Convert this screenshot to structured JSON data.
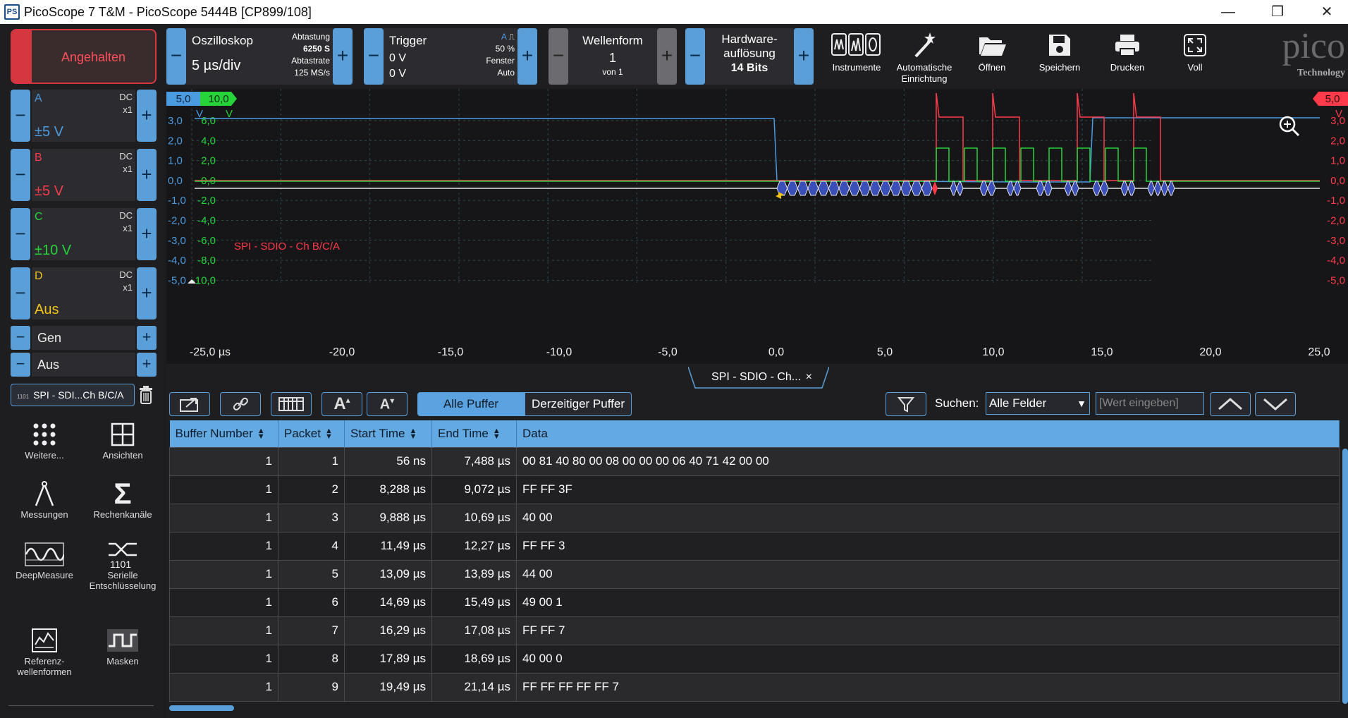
{
  "window": {
    "title": "PicoScope 7 T&M  - PicoScope 5444B [CP899/108]",
    "minimize": "—",
    "maximize": "❐",
    "close": "✕"
  },
  "left": {
    "stop_label": "Angehalten",
    "channels": [
      {
        "name": "A",
        "coupling": "DC",
        "probe": "x1",
        "range": "±5 V",
        "color": "#4b9be0"
      },
      {
        "name": "B",
        "coupling": "DC",
        "probe": "x1",
        "range": "±5 V",
        "color": "#ff3b4b"
      },
      {
        "name": "C",
        "coupling": "DC",
        "probe": "x1",
        "range": "±10 V",
        "color": "#26d43a"
      },
      {
        "name": "D",
        "coupling": "DC",
        "probe": "x1",
        "range": "Aus",
        "color": "#f0c419"
      }
    ],
    "gen_label": "Gen",
    "aus_label": "Aus",
    "decoder_chip": "SPI - SDI...Ch B/C/A",
    "decoder_chip_mini": "1101",
    "tools": [
      {
        "label": "Weitere...",
        "icon": "dots-grid-icon"
      },
      {
        "label": "Ansichten",
        "icon": "grid-icon"
      },
      {
        "label": "Messungen",
        "icon": "calipers-icon"
      },
      {
        "label": "Rechenkanäle",
        "icon": "sigma-icon"
      },
      {
        "label": "DeepMeasure",
        "icon": "waveform-icon"
      },
      {
        "label": "Serielle Entschlüsselung",
        "icon": "serial-decode-icon"
      },
      {
        "label": "Referenz-wellenformen",
        "icon": "reference-icon"
      },
      {
        "label": "Masken",
        "icon": "mask-icon"
      }
    ]
  },
  "toolbar": {
    "scope": {
      "label": "Oszilloskop",
      "value": "5 µs/div",
      "sampling_label": "Abtastung",
      "samples": "6250 S",
      "rate_label": "Abtastrate",
      "rate": "125 MS/s"
    },
    "trigger": {
      "label": "Trigger",
      "line1": "0 V",
      "line2": "0 V",
      "channel": "A",
      "percent": "50 %",
      "window": "Fenster",
      "mode": "Auto"
    },
    "waveform": {
      "label": "Wellenform",
      "value": "1",
      "of": "von 1"
    },
    "hw": {
      "label1": "Hardware-",
      "label2": "auflösung",
      "value": "14 Bits"
    },
    "buttons": [
      {
        "label": "Instrumente",
        "icon": "instruments-icon"
      },
      {
        "label": "Automatische Einrichtung",
        "icon": "wand-icon"
      },
      {
        "label": "Öffnen",
        "icon": "folder-icon"
      },
      {
        "label": "Speichern",
        "icon": "save-icon"
      },
      {
        "label": "Drucken",
        "icon": "printer-icon"
      },
      {
        "label": "Voll",
        "icon": "fullscreen-icon"
      }
    ],
    "logo": "pico",
    "logo_sub": "Technology"
  },
  "scope": {
    "left_scale_a": "5,0",
    "left_scale_c": "10,0",
    "unit_v": "V",
    "right_scale_b": "5,0",
    "a_ticks": [
      "3,0",
      "2,0",
      "1,0",
      "0,0",
      "-1,0",
      "-2,0",
      "-3,0",
      "-4,0",
      "-5,0"
    ],
    "c_ticks": [
      "6,0",
      "4,0",
      "2,0",
      "0,0",
      "-2,0",
      "-4,0",
      "-6,0",
      "-8,0",
      "-10,0"
    ],
    "b_ticks": [
      "3,0",
      "2,0",
      "1,0",
      "0,0",
      "-1,0",
      "-2,0",
      "-3,0",
      "-4,0",
      "-5,0"
    ],
    "x_ticks": [
      "-25,0 µs",
      "-20,0",
      "-15,0",
      "-10,0",
      "-5,0",
      "0,0",
      "5,0",
      "10,0",
      "15,0",
      "20,0",
      "25,0"
    ],
    "decoder_label": "SPI - SDIO - Ch B/C/A",
    "colors": {
      "a": "#4b9be0",
      "b": "#ff3b4b",
      "c": "#26d43a",
      "grid": "#2f4a4f"
    }
  },
  "table": {
    "tab_title": "SPI - SDIO - Ch...",
    "tab_close": "×",
    "btn_alle": "Alle Puffer",
    "btn_derzeit": "Derzeitiger Puffer",
    "search_label": "Suchen:",
    "search_field": "Alle Felder",
    "search_placeholder": "[Wert eingeben]",
    "headers": [
      "Buffer Number",
      "Packet",
      "Start Time",
      "End Time",
      "Data"
    ],
    "rows": [
      [
        "1",
        "1",
        "56 ns",
        "7,488 µs",
        "00 81 40 80 00 08 00 00 00 06 40 71 42 00 00"
      ],
      [
        "1",
        "2",
        "8,288 µs",
        "9,072 µs",
        "FF FF 3F"
      ],
      [
        "1",
        "3",
        "9,888 µs",
        "10,69 µs",
        "40 00"
      ],
      [
        "1",
        "4",
        "11,49 µs",
        "12,27 µs",
        "FF FF 3"
      ],
      [
        "1",
        "5",
        "13,09 µs",
        "13,89 µs",
        "44 00"
      ],
      [
        "1",
        "6",
        "14,69 µs",
        "15,49 µs",
        "49 00 1"
      ],
      [
        "1",
        "7",
        "16,29 µs",
        "17,08 µs",
        "FF FF 7"
      ],
      [
        "1",
        "8",
        "17,89 µs",
        "18,69 µs",
        "40 00 0"
      ],
      [
        "1",
        "9",
        "19,49 µs",
        "21,14 µs",
        "FF FF FF FF FF 7"
      ]
    ]
  }
}
